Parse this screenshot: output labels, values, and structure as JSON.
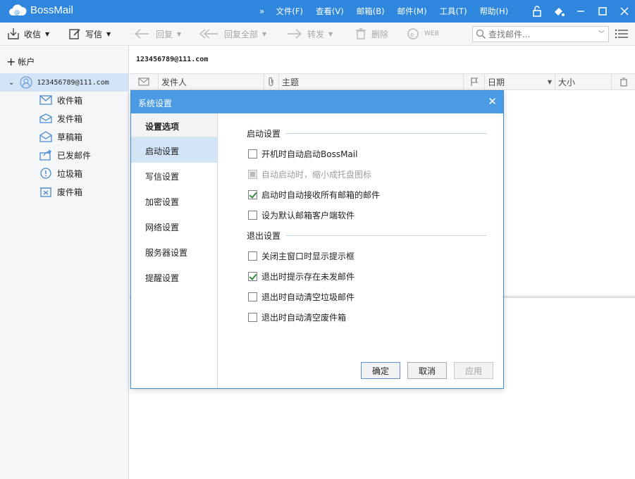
{
  "app": {
    "title": "BossMail",
    "menu": [
      "文件(F)",
      "查看(V)",
      "邮箱(B)",
      "邮件(M)",
      "工具(T)",
      "帮助(H)"
    ],
    "window_icons": [
      "lock-icon",
      "skin-icon",
      "minimize-icon",
      "maximize-icon",
      "close-icon"
    ]
  },
  "toolbar": {
    "receive": "收信",
    "compose": "写信",
    "reply": "回复",
    "reply_all": "回复全部",
    "forward": "转发",
    "delete": "删除",
    "web": "WEB",
    "search_placeholder": "查找邮件..."
  },
  "sidebar": {
    "add_account": "帐户",
    "account": "123456789@111.com",
    "folders": [
      "收件箱",
      "发件箱",
      "草稿箱",
      "已发邮件",
      "垃圾箱",
      "废件箱"
    ]
  },
  "main": {
    "account": "123456789@111.com",
    "columns": {
      "sender": "发件人",
      "subject": "主题",
      "date": "日期",
      "size": "大小"
    }
  },
  "dialog": {
    "title": "系统设置",
    "nav_header": "设置选项",
    "nav_items": [
      "启动设置",
      "写信设置",
      "加密设置",
      "网络设置",
      "服务器设置",
      "提醒设置"
    ],
    "active_nav": "启动设置",
    "sections": {
      "startup": {
        "title": "启动设置",
        "options": [
          {
            "label": "开机时自动启动BossMail",
            "checked": false,
            "disabled": false
          },
          {
            "label": "自动启动时，缩小成托盘图标",
            "checked": false,
            "disabled": true
          },
          {
            "label": "启动时自动接收所有邮箱的邮件",
            "checked": true,
            "disabled": false
          },
          {
            "label": "设为默认邮箱客户端软件",
            "checked": false,
            "disabled": false
          }
        ]
      },
      "exit": {
        "title": "退出设置",
        "options": [
          {
            "label": "关闭主窗口时显示提示框",
            "checked": false,
            "disabled": false
          },
          {
            "label": "退出时提示存在未发邮件",
            "checked": true,
            "disabled": false
          },
          {
            "label": "退出时自动清空垃圾邮件",
            "checked": false,
            "disabled": false
          },
          {
            "label": "退出时自动清空废件箱",
            "checked": false,
            "disabled": false
          }
        ]
      }
    },
    "buttons": {
      "ok": "确定",
      "cancel": "取消",
      "apply": "应用"
    }
  },
  "colors": {
    "titlebar": "#2e86dd",
    "selection": "#d3e4f7",
    "dialog_title": "#4a9be4"
  }
}
